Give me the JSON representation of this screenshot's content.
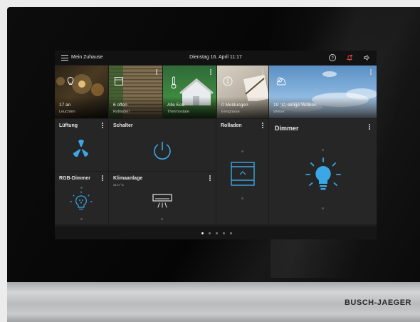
{
  "header": {
    "title": "Mein Zuhause",
    "datetime": "Dienstag 16. April 11:17"
  },
  "status_tiles": [
    {
      "value": "17 an",
      "caption": "Leuchten"
    },
    {
      "value": "6 offen",
      "caption": "Rollladen"
    },
    {
      "value": "Alle Eco",
      "caption": "Thermostate"
    },
    {
      "value": "0 Meldungen",
      "caption": "Ereignisse"
    },
    {
      "value": "19 °C, einige Wolken",
      "caption": "Wetter"
    }
  ],
  "control_tiles": {
    "lueftung": {
      "label": "Lüftung"
    },
    "schalter": {
      "label": "Schalter"
    },
    "rollladen": {
      "label": "Rolladen"
    },
    "dimmer": {
      "label": "Dimmer"
    },
    "rgb_dimmer": {
      "label": "RGB-Dimmer"
    },
    "klima": {
      "label": "Klimaanlage",
      "temp": "21.0 °C"
    }
  },
  "pager": {
    "pages": 5,
    "active": 0
  },
  "brand": "BUSCH-JAEGER",
  "colors": {
    "accent": "#3ba7e6",
    "alert": "#e0483e"
  },
  "icons": [
    "menu-icon",
    "help-icon",
    "bell-icon",
    "speaker-icon",
    "fan-icon",
    "power-icon",
    "blind-icon",
    "bulb-icon",
    "rgb-bulb-icon",
    "ac-icon",
    "thermometer-icon",
    "info-icon",
    "weather-icon"
  ]
}
